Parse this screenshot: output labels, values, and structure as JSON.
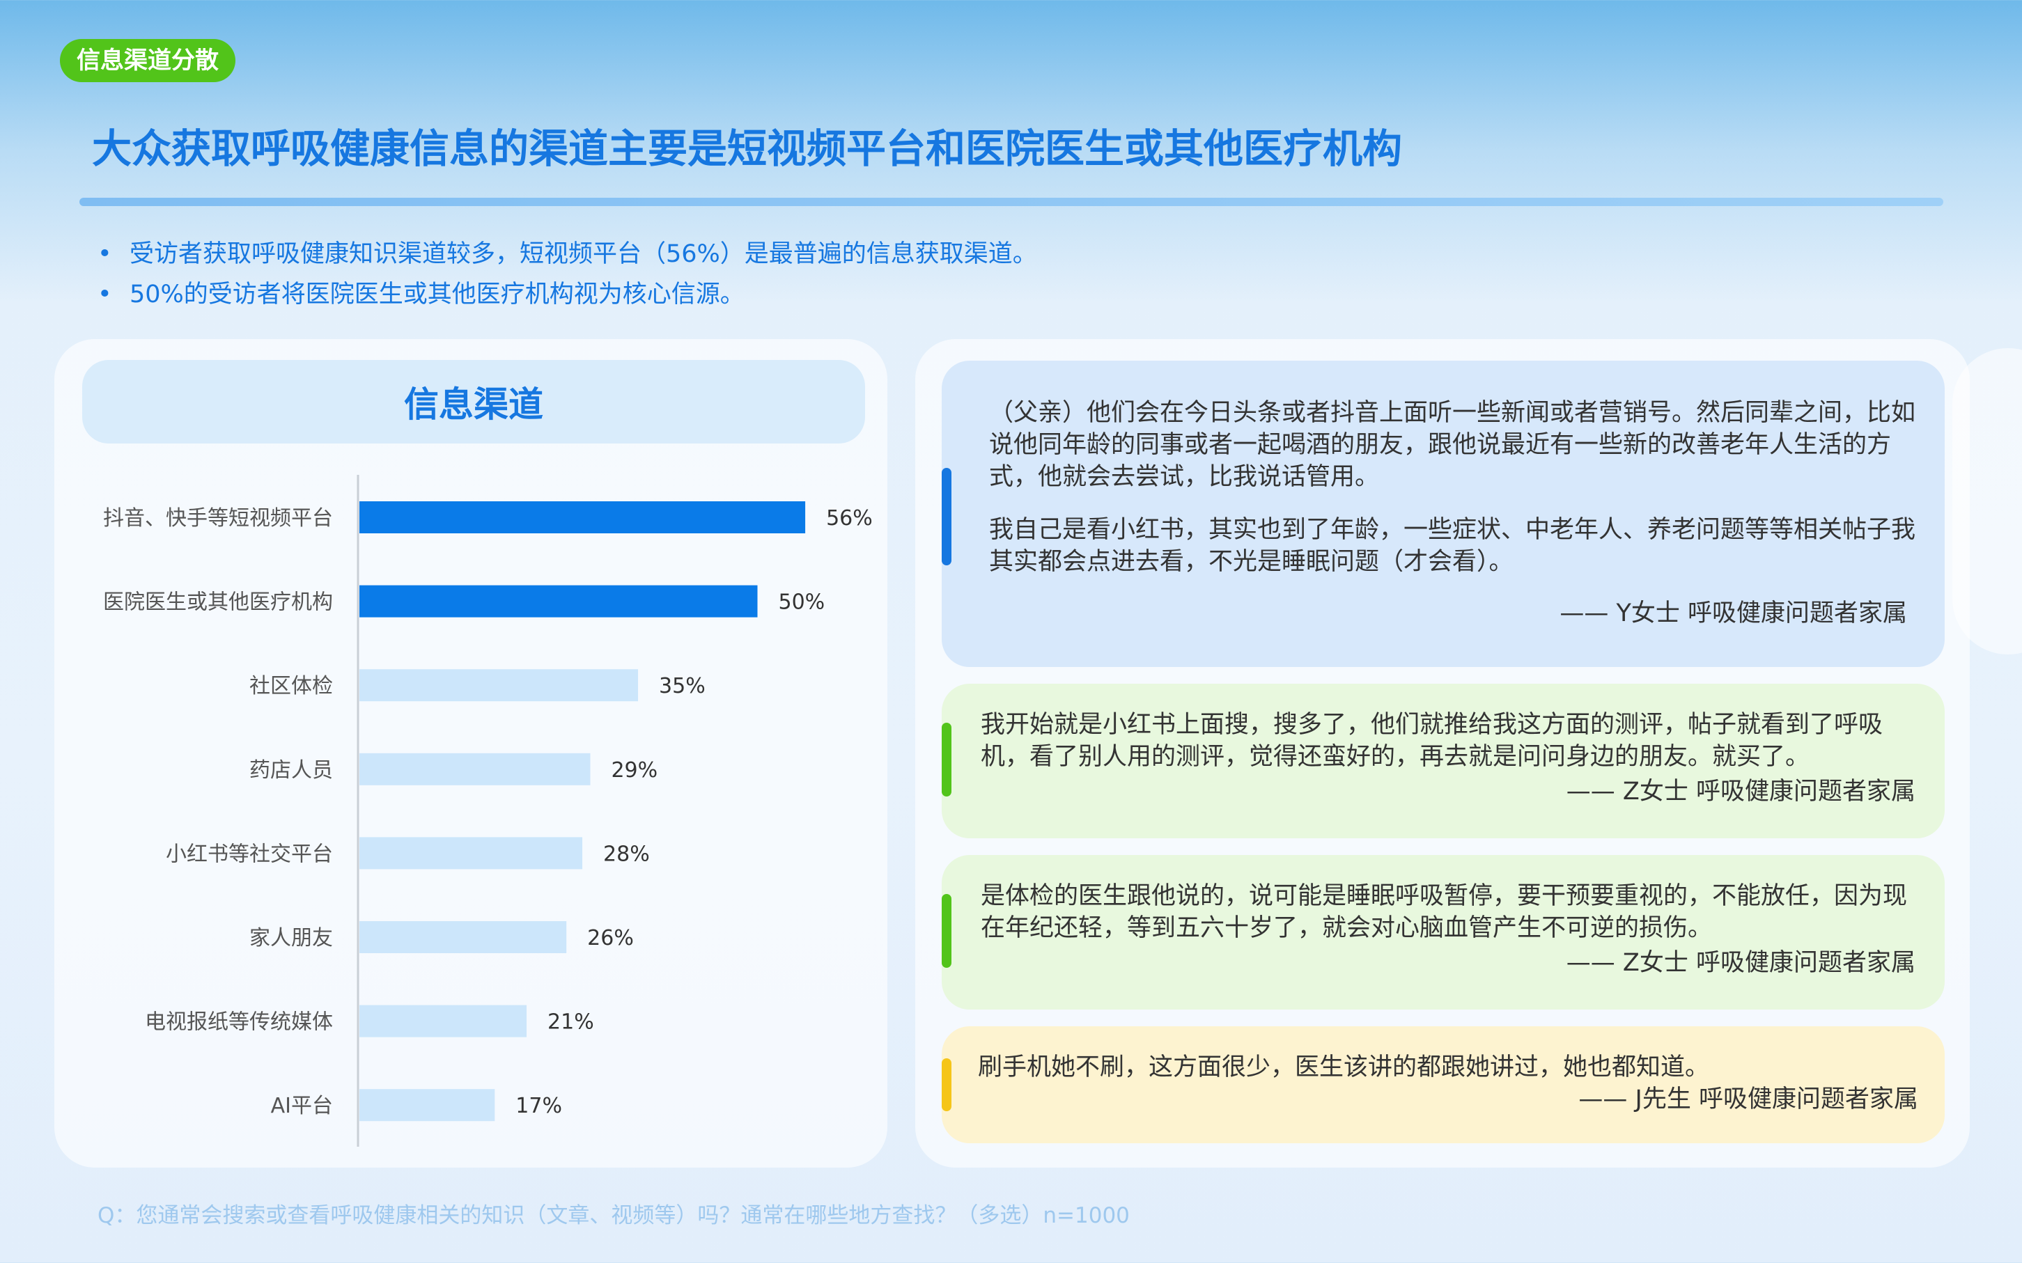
{
  "tag": "信息渠道分散",
  "title": "大众获取呼吸健康信息的渠道主要是短视频平台和医院医生或其他医疗机构",
  "bullets": [
    "受访者获取呼吸健康知识渠道较多，短视频平台（56%）是最普遍的信息获取渠道。",
    "50%的受访者将医院医生或其他医疗机构视为核心信源。"
  ],
  "bullet_symbol": "•",
  "chart_panel_title": "信息渠道",
  "colors": {
    "title_blue": "#1677e0",
    "highlight_bar": "#0a7be8",
    "normal_bar": "#cce6fb",
    "tag_green": "#52c41a",
    "accent_blue": "#1677e0",
    "accent_green": "#52c41a",
    "accent_yellow": "#f5c518"
  },
  "chart_data": {
    "type": "bar",
    "orientation": "horizontal",
    "categories": [
      "抖音、快手等短视频平台",
      "医院医生或其他医疗机构",
      "社区体检",
      "药店人员",
      "小红书等社交平台",
      "家人朋友",
      "电视报纸等传统媒体",
      "AI平台"
    ],
    "values": [
      56,
      50,
      35,
      29,
      28,
      26,
      21,
      17
    ],
    "value_labels": [
      "56%",
      "50%",
      "35%",
      "29%",
      "28%",
      "26%",
      "21%",
      "17%"
    ],
    "highlighted": [
      true,
      true,
      false,
      false,
      false,
      false,
      false,
      false
    ],
    "unit": "%",
    "xlim": [
      0,
      100
    ],
    "grid": false,
    "legend": "none"
  },
  "quotes": [
    {
      "paragraphs": [
        "（父亲）他们会在今日头条或者抖音上面听一些新闻或者营销号。然后同辈之间，比如说他同年龄的同事或者一起喝酒的朋友，跟他说最近有一些新的改善老年人生活的方式，他就会去尝试，比我说话管用。",
        "我自己是看小红书，其实也到了年龄，一些症状、中老年人、养老问题等等相关帖子我其实都会点进去看，不光是睡眠问题（才会看）。"
      ],
      "author": "—— Y女士 呼吸健康问题者家属",
      "accent": "blue"
    },
    {
      "paragraphs": [
        "我开始就是小红书上面搜，搜多了，他们就推给我这方面的测评，帖子就看到了呼吸机，看了别人用的测评，觉得还蛮好的，再去就是问问身边的朋友。就买了。"
      ],
      "author": "—— Z女士 呼吸健康问题者家属",
      "accent": "green"
    },
    {
      "paragraphs": [
        "是体检的医生跟他说的，说可能是睡眠呼吸暂停，要干预要重视的，不能放任，因为现在年纪还轻，等到五六十岁了，就会对心脑血管产生不可逆的损伤。"
      ],
      "author": "—— Z女士 呼吸健康问题者家属",
      "accent": "green"
    },
    {
      "paragraphs": [
        "刷手机她不刷，这方面很少，医生该讲的都跟她讲过，她也都知道。"
      ],
      "author": "—— J先生 呼吸健康问题者家属",
      "accent": "yellow"
    }
  ],
  "footnote": "Q：您通常会搜索或查看呼吸健康相关的知识（文章、视频等）吗？通常在哪些地方查找？（多选）n=1000"
}
